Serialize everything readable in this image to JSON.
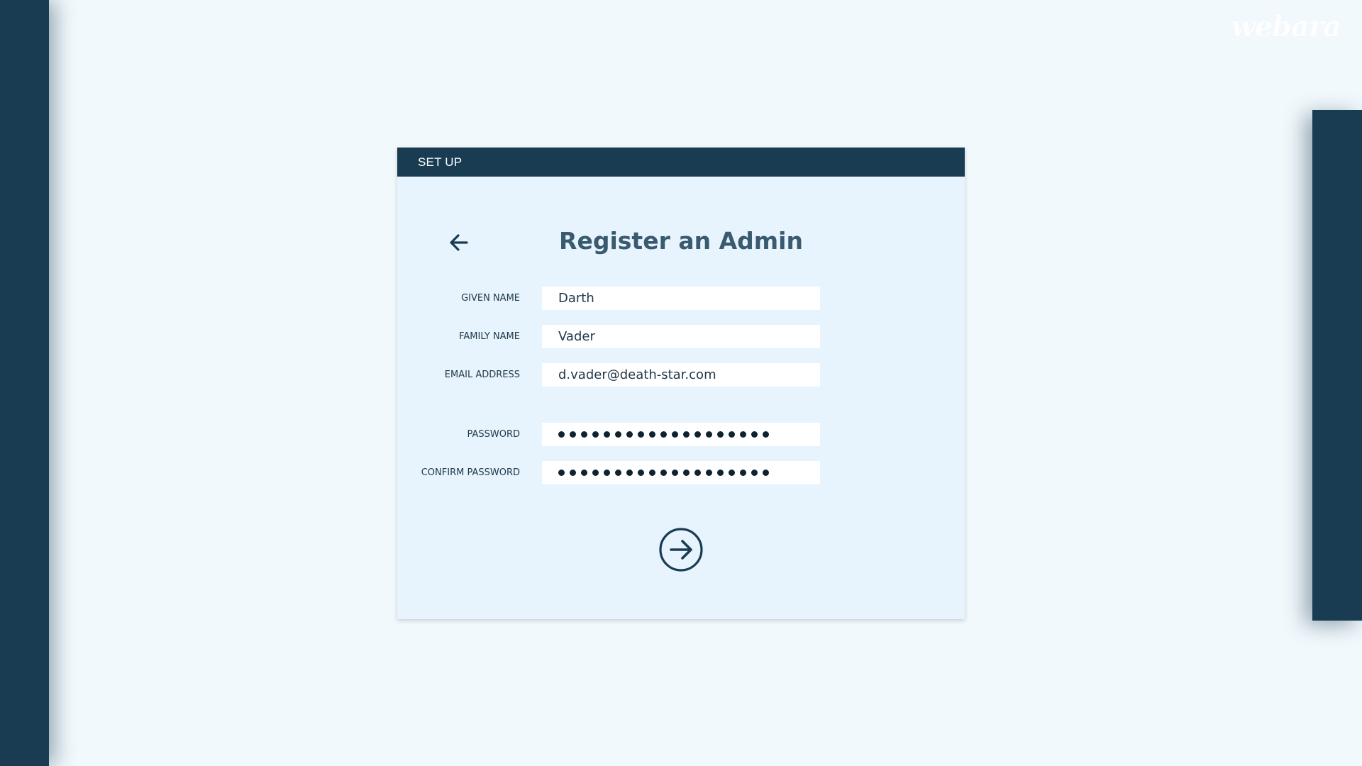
{
  "brand": {
    "watermark": "webara"
  },
  "dialog": {
    "header_title": "SET UP",
    "title": "Register an Admin",
    "back_icon": "arrow-left-icon",
    "next_icon": "arrow-right-circle-icon"
  },
  "form": {
    "given_name": {
      "label": "GIVEN NAME",
      "value": "Darth"
    },
    "family_name": {
      "label": "FAMILY NAME",
      "value": "Vader"
    },
    "email": {
      "label": "EMAIL ADDRESS",
      "value": "d.vader@death-star.com"
    },
    "password": {
      "label": "PASSWORD",
      "masked_length": 19
    },
    "confirm_password": {
      "label": "CONFIRM PASSWORD",
      "masked_length": 19
    }
  },
  "colors": {
    "navy": "#1a3c53",
    "background": "#f2f9fd",
    "dialog_body": "#e7f4fd",
    "title": "#3a5a6f"
  }
}
